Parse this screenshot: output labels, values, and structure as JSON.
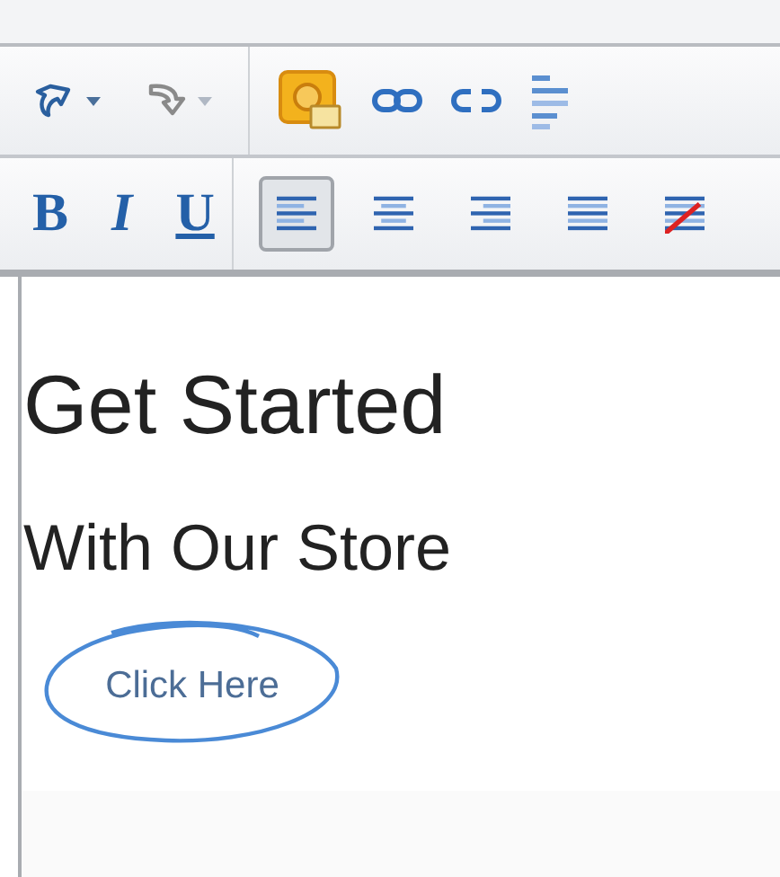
{
  "toolbar": {
    "history": [
      {
        "kind": "undo",
        "disabled": false
      },
      {
        "kind": "redo",
        "disabled": true
      }
    ],
    "insert": [
      {
        "kind": "image"
      },
      {
        "kind": "link"
      },
      {
        "kind": "unlink"
      },
      {
        "kind": "list"
      }
    ],
    "format": [
      {
        "kind": "bold",
        "label": "B"
      },
      {
        "kind": "italic",
        "label": "I"
      },
      {
        "kind": "underline",
        "label": "U"
      }
    ],
    "alignment": [
      {
        "kind": "left",
        "selected": true
      },
      {
        "kind": "center",
        "selected": false
      },
      {
        "kind": "right",
        "selected": false
      },
      {
        "kind": "justify",
        "selected": false
      },
      {
        "kind": "clear",
        "selected": false
      }
    ]
  },
  "content": {
    "heading": "Get Started",
    "subheading": "With Our Store",
    "link": {
      "text": "Click Here",
      "circled": true
    }
  }
}
